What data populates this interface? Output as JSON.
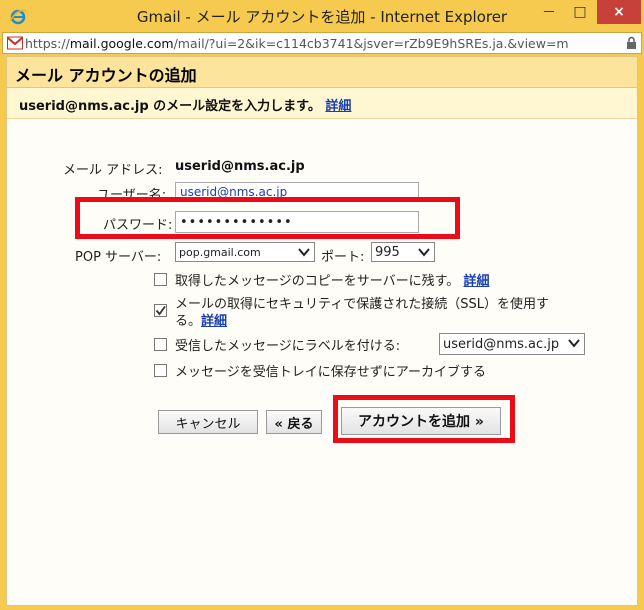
{
  "window": {
    "title": "Gmail - メール アカウントを追加 - Internet Explorer",
    "min_label": "－",
    "max_label": "□",
    "close_label": "×"
  },
  "address_bar": {
    "url_prefix": "https://",
    "url_host": "mail.google.com",
    "url_rest": "/mail/?ui=2&ik=c114cb3741&jsver=rZb9E9hSREs.ja.&view=m"
  },
  "dialog": {
    "title": "メール アカウントの追加",
    "subheading": "userid@nms.ac.jp のメール設定を入力します。",
    "subheading_link": "詳細"
  },
  "form": {
    "email_label": "メール アドレス:",
    "email_value": "userid@nms.ac.jp",
    "username_label": "ユーザー名:",
    "username_value": "userid@nms.ac.jp",
    "password_label": "パスワード:",
    "password_value": "•••••••••••••",
    "pop_label": "POP サーバー:",
    "pop_value": "pop.gmail.com",
    "port_label": "ポート:",
    "port_value": "995"
  },
  "options": {
    "leave_copy": {
      "label": "取得したメッセージのコピーをサーバーに残す。",
      "link": "詳細",
      "checked": false
    },
    "ssl": {
      "label_line1": "メールの取得にセキュリティで保護された接続（SSL）を使用す",
      "label_line2": "る。",
      "link": "詳細",
      "checked": true
    },
    "label_incoming": {
      "label": "受信したメッセージにラベルを付ける:",
      "select_value": "userid@nms.ac.jp",
      "checked": false
    },
    "archive": {
      "label": "メッセージを受信トレイに保存せずにアーカイブする",
      "checked": false
    }
  },
  "buttons": {
    "cancel": "キャンセル",
    "back": "« 戻る",
    "add_account": "アカウントを追加 »"
  },
  "colors": {
    "frame": "#f6c94f",
    "header": "#fde49c",
    "highlight": "#ec0c17",
    "link": "#1a3fb0"
  }
}
